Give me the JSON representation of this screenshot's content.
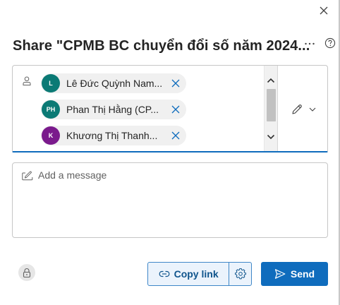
{
  "dialog": {
    "title": "Share \"CPMB BC chuyển đổi số năm 2024...",
    "close_icon": "close-icon",
    "more_icon": "more-options-icon",
    "help_icon": "help-icon"
  },
  "recipients": {
    "field_icon": "person-icon",
    "chips": [
      {
        "initials": "L",
        "name": "Lê Đức Quỳnh Nam...",
        "avatar_color": "#0b7a75"
      },
      {
        "initials": "PH",
        "name": "Phan Thị Hằng (CP...",
        "avatar_color": "#0b7a75"
      },
      {
        "initials": "K",
        "name": "Khương Thị Thanh...",
        "avatar_color": "#7a1a8c"
      }
    ],
    "remove_icon": "dismiss-icon",
    "permission_icon": "edit-pencil-icon",
    "permission_dropdown_icon": "chevron-down-icon"
  },
  "message": {
    "placeholder": "Add a message",
    "value": "",
    "icon": "message-edit-icon"
  },
  "footer": {
    "lock_icon": "lock-icon",
    "copy_link_label": "Copy link",
    "copy_link_icon": "link-icon",
    "settings_icon": "gear-icon",
    "send_label": "Send",
    "send_icon": "send-icon"
  },
  "colors": {
    "accent": "#0f6cbd",
    "copy_link_bg": "#ebf3fc",
    "copy_link_text": "#0f548c"
  }
}
